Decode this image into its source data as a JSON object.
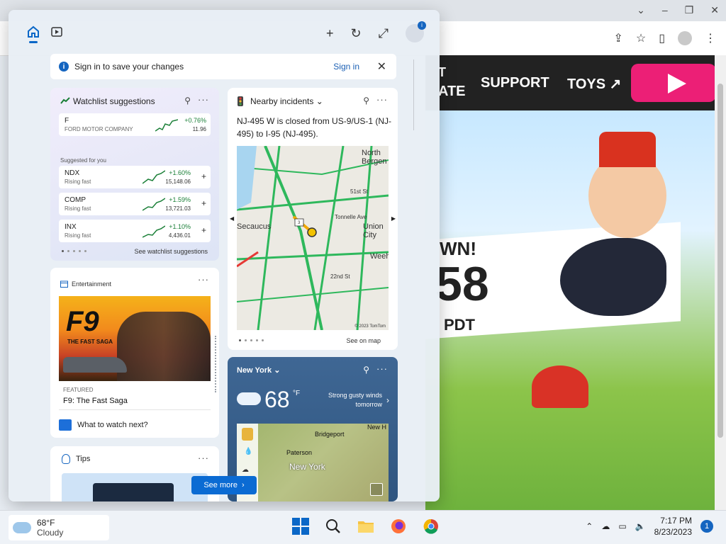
{
  "site": {
    "nav_fragment_1": "T",
    "nav_fragment_2": "ATE",
    "nav_support": "SUPPORT",
    "nav_toys": "TOYS",
    "banner_won": "WN!",
    "banner_num": "58",
    "banner_pdt": "PDT"
  },
  "widgets": {
    "signin_bar": {
      "text": "Sign in to save your changes",
      "link": "Sign in"
    },
    "watchlist": {
      "title": "Watchlist suggestions",
      "featured": {
        "symbol": "F",
        "name": "FORD MOTOR COMPANY",
        "change": "+0.76%",
        "value": "11.96"
      },
      "suggested_label": "Suggested for you",
      "items": [
        {
          "symbol": "NDX",
          "sub": "Rising fast",
          "change": "+1.60%",
          "value": "15,148.06"
        },
        {
          "symbol": "COMP",
          "sub": "Rising fast",
          "change": "+1.59%",
          "value": "13,721.03"
        },
        {
          "symbol": "INX",
          "sub": "Rising fast",
          "change": "+1.10%",
          "value": "4,436.01"
        }
      ],
      "see_link": "See watchlist suggestions"
    },
    "incidents": {
      "title": "Nearby incidents",
      "text": "NJ-495 W is closed from US-9/US-1 (NJ-495) to I-95 (NJ-495).",
      "map_labels": [
        "North Bergen",
        "Union City",
        "Weehawken",
        "Secaucus",
        "51st St",
        "Tonnelle Ave",
        "22nd St",
        "3"
      ],
      "copyright": "© 2023 TomTom",
      "see_link": "See on map"
    },
    "entertainment": {
      "title": "Entertainment",
      "poster_title": "F9",
      "poster_sub": "THE FAST SAGA",
      "featured_label": "FEATURED",
      "movie_name": "F9: The Fast Saga",
      "watch_next": "What to watch next?"
    },
    "weather": {
      "location": "New York",
      "temp": "68",
      "unit": "°F",
      "wind": "Strong gusty winds tomorrow",
      "map_cities": [
        "Bridgeport",
        "New H",
        "Paterson",
        "New York"
      ]
    },
    "tips": {
      "title": "Tips"
    },
    "see_more": "See more"
  },
  "taskbar": {
    "weather_temp": "68°F",
    "weather_desc": "Cloudy",
    "time": "7:17 PM",
    "date": "8/23/2023",
    "notifications": "1"
  },
  "colors": {
    "accent": "#0b6bd3",
    "positive": "#1a7f37",
    "play_button": "#ec1f76"
  }
}
